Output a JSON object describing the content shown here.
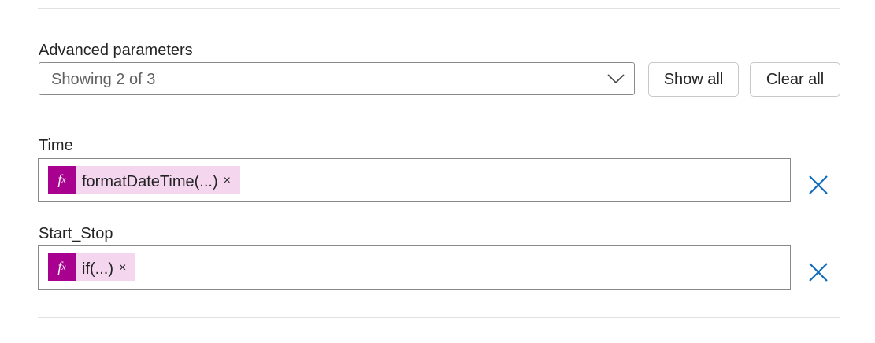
{
  "advanced": {
    "label": "Advanced parameters",
    "dropdown_value": "Showing 2 of 3",
    "show_all_label": "Show all",
    "clear_all_label": "Clear all"
  },
  "params": [
    {
      "label": "Time",
      "token_icon": "fx-icon",
      "token_text": "formatDateTime(...)",
      "token_remove": "×"
    },
    {
      "label": "Start_Stop",
      "token_icon": "fx-icon",
      "token_text": "if(...)",
      "token_remove": "×"
    }
  ],
  "colors": {
    "accent": "#0f6cbd",
    "token_bg": "#f4d6ef",
    "fx_bg": "#a8008f",
    "border": "#8a8a8a"
  }
}
